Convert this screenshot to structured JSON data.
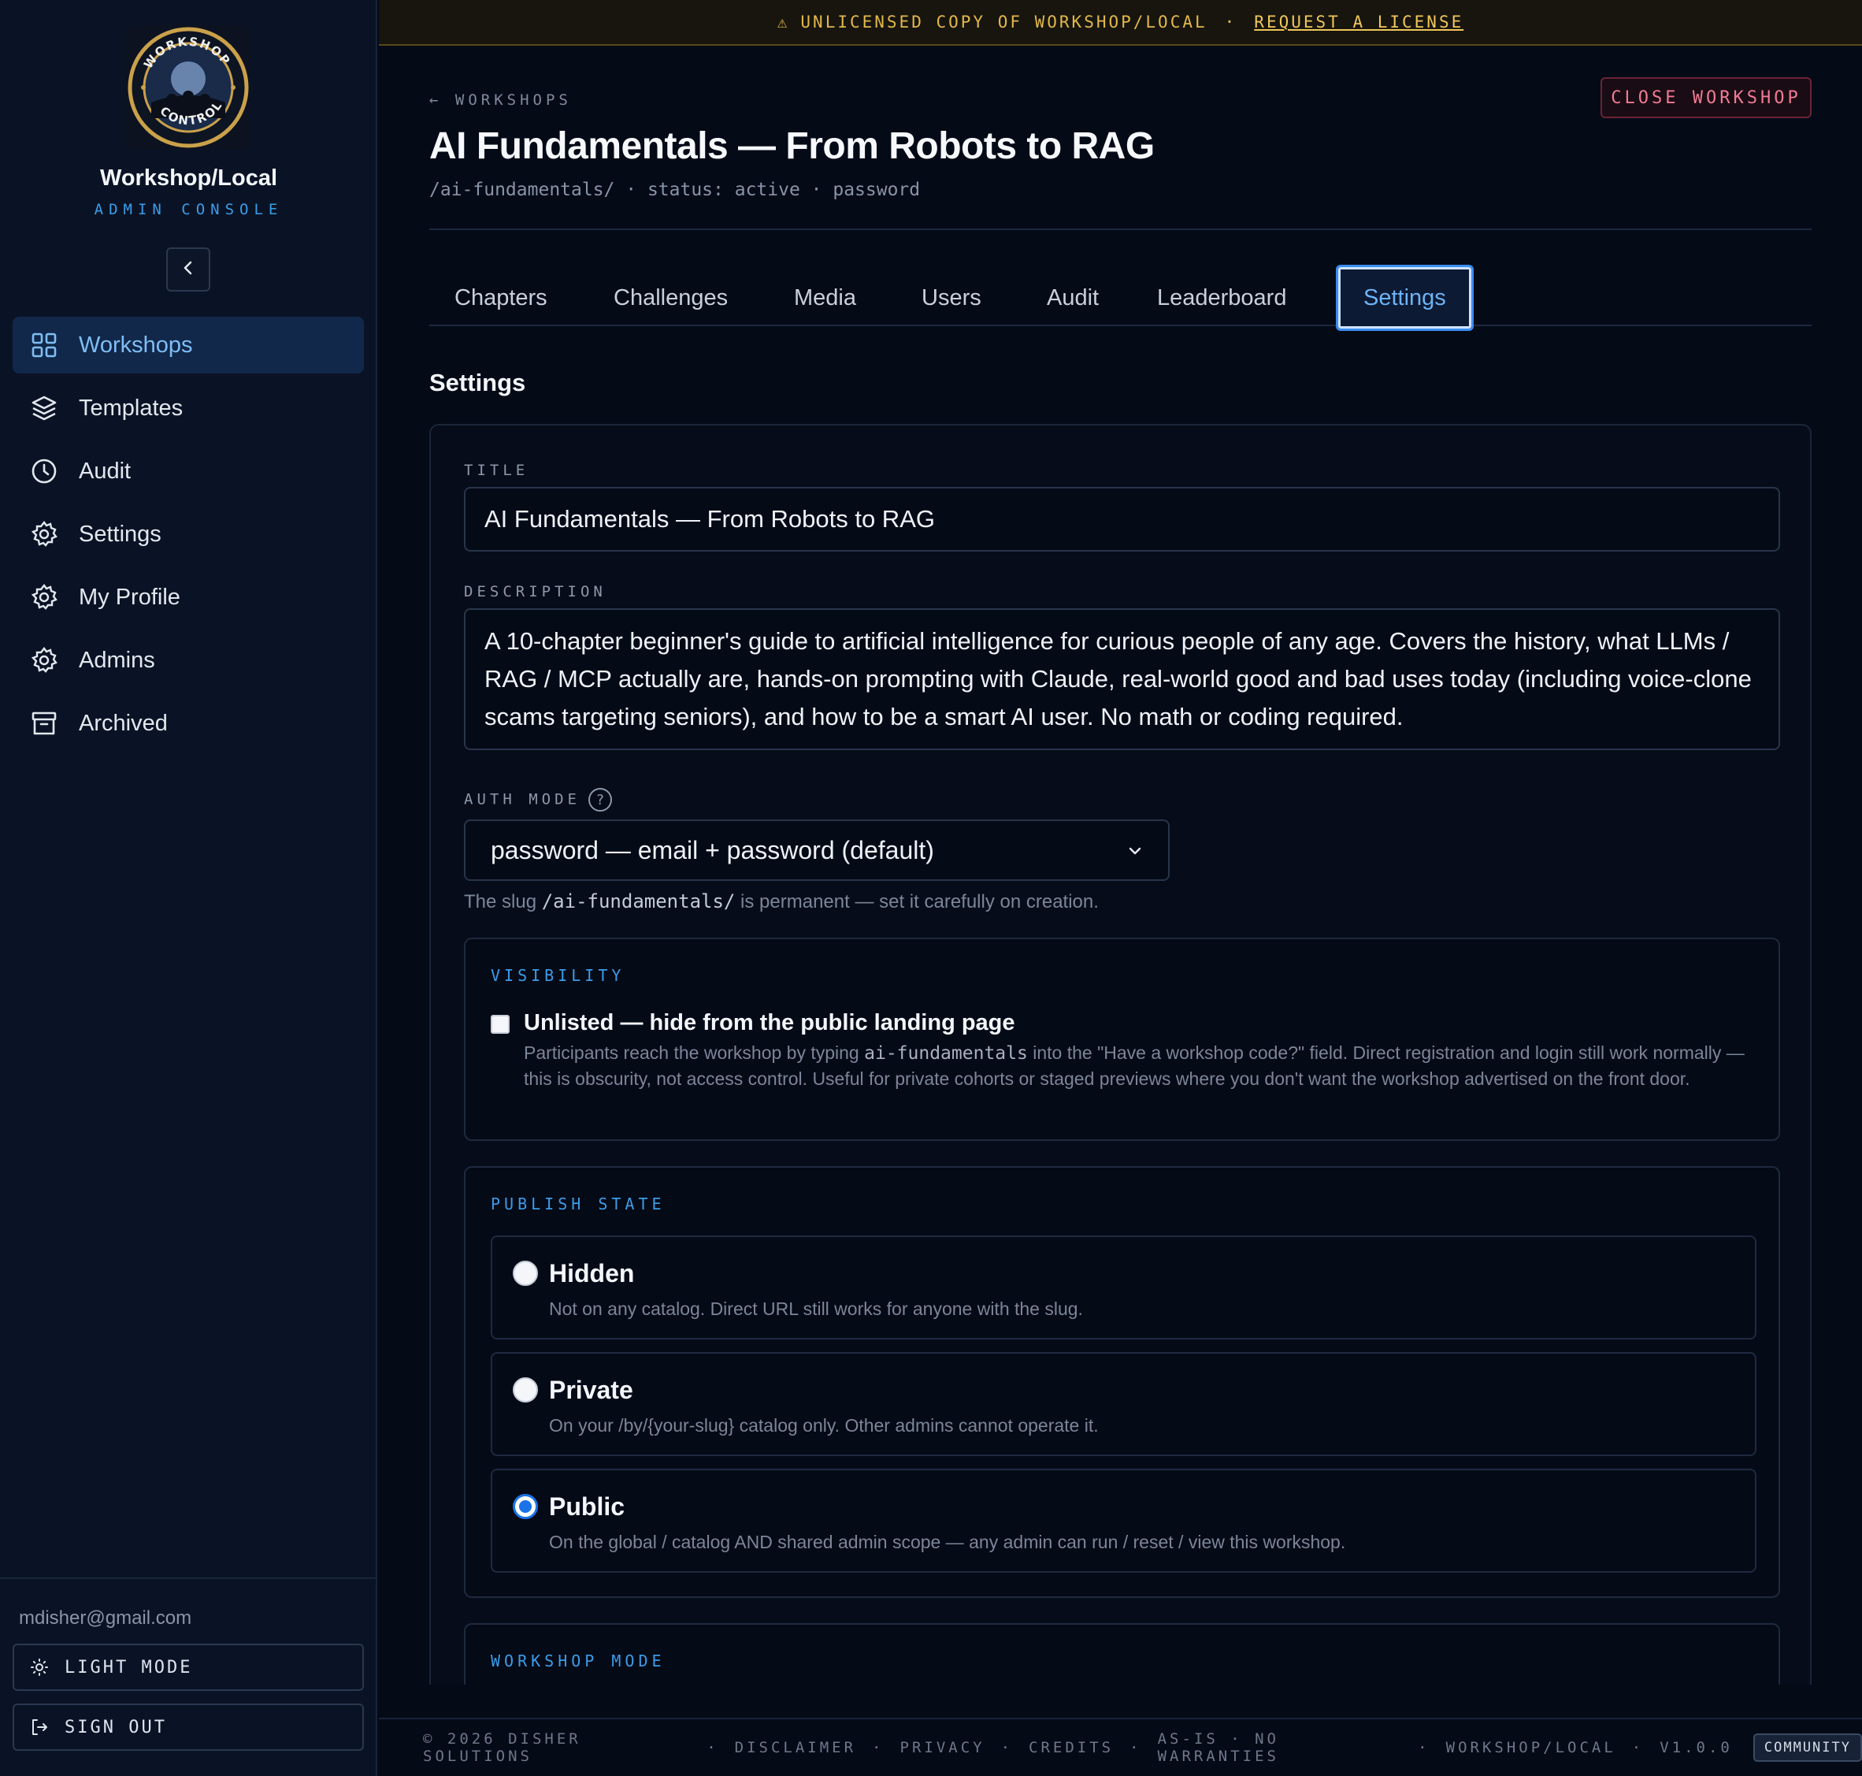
{
  "banner": {
    "warning_icon": "⚠",
    "text": "UNLICENSED COPY OF WORKSHOP/LOCAL",
    "separator": "·",
    "link": "REQUEST A LICENSE"
  },
  "sidebar": {
    "brand": "Workshop/Local",
    "subtitle": "ADMIN CONSOLE",
    "items": [
      {
        "label": "Workshops",
        "icon": "grid-icon",
        "active": true
      },
      {
        "label": "Templates",
        "icon": "layers-icon"
      },
      {
        "label": "Audit",
        "icon": "clock-icon"
      },
      {
        "label": "Settings",
        "icon": "gear-icon"
      },
      {
        "label": "My Profile",
        "icon": "gear-icon"
      },
      {
        "label": "Admins",
        "icon": "gear-icon"
      },
      {
        "label": "Archived",
        "icon": "archive-icon"
      }
    ],
    "user_email": "mdisher@gmail.com",
    "light_mode_label": "LIGHT MODE",
    "sign_out_label": "SIGN OUT"
  },
  "header": {
    "back_label": "← WORKSHOPS",
    "close_label": "CLOSE WORKSHOP",
    "title": "AI Fundamentals — From Robots to RAG",
    "meta": "/ai-fundamentals/ · status: active · password"
  },
  "tabs": [
    "Chapters",
    "Challenges",
    "Media",
    "Users",
    "Audit",
    "Leaderboard",
    "Settings"
  ],
  "active_tab": "Settings",
  "settings": {
    "heading": "Settings",
    "title_label": "TITLE",
    "title_value": "AI Fundamentals — From Robots to RAG",
    "description_label": "DESCRIPTION",
    "description_value": "A 10-chapter beginner's guide to artificial intelligence for curious people of any age. Covers the history, what LLMs / RAG / MCP actually are, hands-on prompting with Claude, real-world good and bad uses today (including voice-clone scams targeting seniors), and how to be a smart AI user. No math or coding required.",
    "auth_label": "AUTH MODE",
    "auth_help": "?",
    "auth_value": "password — email + password (default)",
    "slug_hint_pre": "The slug",
    "slug_hint_code": "/ai-fundamentals/",
    "slug_hint_post": "is permanent — set it carefully on creation.",
    "visibility": {
      "title": "VISIBILITY",
      "checkbox_label": "Unlisted — hide from the public landing page",
      "checked": false,
      "desc_pre": "Participants reach the workshop by typing",
      "desc_code": "ai-fundamentals",
      "desc_post": "into the \"Have a workshop code?\" field. Direct registration and login still work normally — this is obscurity, not access control. Useful for private cohorts or staged previews where you don't want the workshop advertised on the front door."
    },
    "publish": {
      "title": "PUBLISH STATE",
      "selected": "Public",
      "options": [
        {
          "label": "Hidden",
          "desc": "Not on any catalog. Direct URL still works for anyone with the slug."
        },
        {
          "label": "Private",
          "desc": "On your /by/{your-slug} catalog only. Other admins cannot operate it."
        },
        {
          "label": "Public",
          "desc": "On the global / catalog AND shared admin scope — any admin can run / reset / view this workshop."
        }
      ]
    },
    "workshop_mode_title": "WORKSHOP MODE"
  },
  "footer": {
    "copyright": "© 2026 DISHER SOLUTIONS",
    "links": [
      "DISCLAIMER",
      "PRIVACY",
      "CREDITS",
      "AS-IS · NO WARRANTIES",
      "WORKSHOP/LOCAL",
      "V1.0.0"
    ],
    "separator": "·",
    "badge": "COMMUNITY"
  },
  "colors": {
    "accent": "#3b9ce8",
    "danger": "#f07b94",
    "warning": "#e2b84a",
    "background": "#050a17"
  }
}
